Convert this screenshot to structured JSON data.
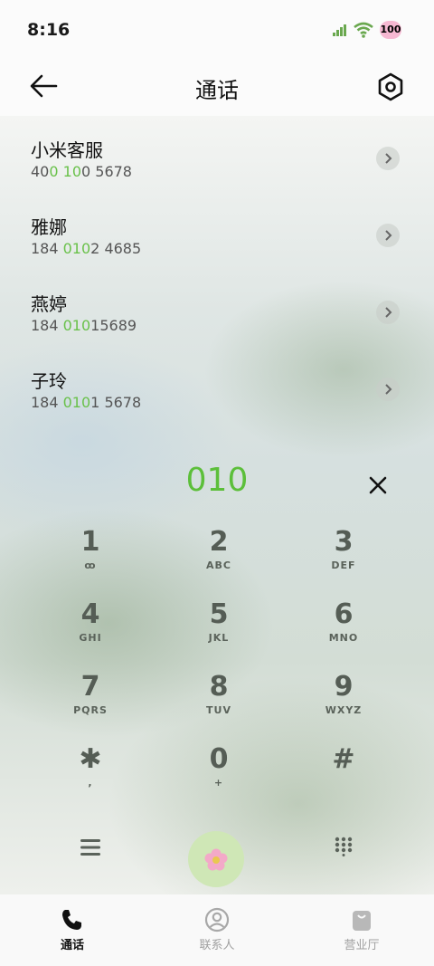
{
  "status": {
    "time": "8:16",
    "battery": "100"
  },
  "header": {
    "title": "通话"
  },
  "contacts": [
    {
      "name": "小米客服",
      "num_pre": "40",
      "num_hl1": "0",
      "num_mid": " ",
      "num_hl2": "10",
      "num_post": "0 5678"
    },
    {
      "name": "雅娜",
      "num_pre": "184 ",
      "num_hl1": "010",
      "num_mid": "",
      "num_hl2": "",
      "num_post": "2 4685"
    },
    {
      "name": "燕婷",
      "num_pre": "184 ",
      "num_hl1": "010",
      "num_mid": "",
      "num_hl2": "",
      "num_post": "15689"
    },
    {
      "name": "子玲",
      "num_pre": "184 ",
      "num_hl1": "010",
      "num_mid": "",
      "num_hl2": "",
      "num_post": "1 5678"
    }
  ],
  "dialer": {
    "input": "010",
    "keys": [
      {
        "digit": "1",
        "letters": "ꝏ"
      },
      {
        "digit": "2",
        "letters": "ABC"
      },
      {
        "digit": "3",
        "letters": "DEF"
      },
      {
        "digit": "4",
        "letters": "GHI"
      },
      {
        "digit": "5",
        "letters": "JKL"
      },
      {
        "digit": "6",
        "letters": "MNO"
      },
      {
        "digit": "7",
        "letters": "PQRS"
      },
      {
        "digit": "8",
        "letters": "TUV"
      },
      {
        "digit": "9",
        "letters": "WXYZ"
      },
      {
        "digit": "✱",
        "letters": ","
      },
      {
        "digit": "0",
        "letters": "+"
      },
      {
        "digit": "#",
        "letters": ""
      }
    ],
    "call_icon": "flower-icon"
  },
  "tabs": [
    {
      "label": "通话",
      "icon": "phone-icon",
      "active": true
    },
    {
      "label": "联系人",
      "icon": "person-icon",
      "active": false
    },
    {
      "label": "营业厅",
      "icon": "bag-icon",
      "active": false
    }
  ],
  "colors": {
    "accent": "#5cbf3a",
    "highlight": "#69c14a",
    "call_button": "#cfe7b6"
  }
}
